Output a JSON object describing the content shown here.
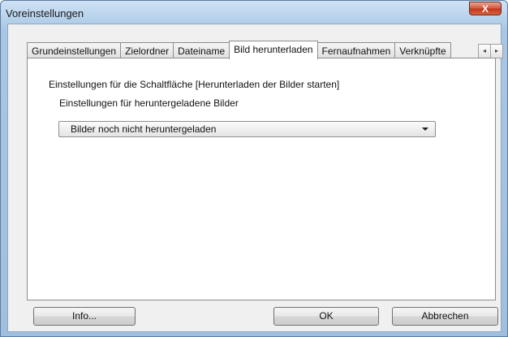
{
  "window": {
    "title": "Voreinstellungen",
    "close_glyph": "X"
  },
  "tabs": [
    {
      "label": "Grundeinstellungen"
    },
    {
      "label": "Zielordner"
    },
    {
      "label": "Dateiname"
    },
    {
      "label": "Bild herunterladen",
      "active": true
    },
    {
      "label": "Fernaufnahmen"
    },
    {
      "label": "Verknüpfte"
    }
  ],
  "tab_scroll": {
    "left_glyph": "◂",
    "right_glyph": "▸"
  },
  "panel": {
    "heading": "Einstellungen für die Schaltfläche [Herunterladen der Bilder starten]",
    "sublabel": "Einstellungen für heruntergeladene Bilder",
    "dropdown_value": "Bilder noch nicht heruntergeladen"
  },
  "buttons": {
    "info": "Info...",
    "ok": "OK",
    "cancel": "Abbrechen"
  }
}
